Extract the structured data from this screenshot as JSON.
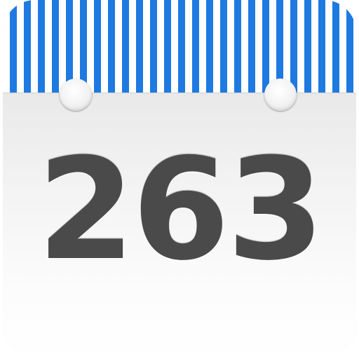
{
  "icon": {
    "number": "263",
    "stripe_color": "#1e7ae0",
    "digit_color": "#4a4a4a",
    "sheet_color": "#f3f3f3"
  }
}
